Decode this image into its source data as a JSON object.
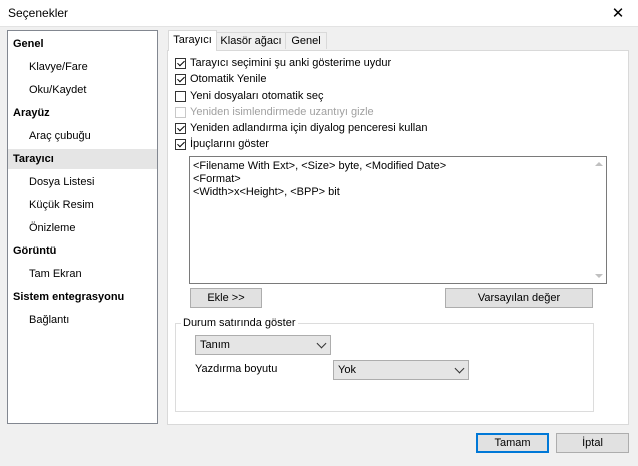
{
  "window": {
    "title": "Seçenekler",
    "close_glyph": "✕"
  },
  "sidebar": {
    "items": [
      {
        "label": "Genel",
        "type": "category"
      },
      {
        "label": "Klavye/Fare",
        "type": "sub"
      },
      {
        "label": "Oku/Kaydet",
        "type": "sub"
      },
      {
        "label": "Arayüz",
        "type": "category"
      },
      {
        "label": "Araç çubuğu",
        "type": "sub"
      },
      {
        "label": "Tarayıcı",
        "type": "category",
        "selected": true
      },
      {
        "label": "Dosya Listesi",
        "type": "sub"
      },
      {
        "label": "Küçük Resim",
        "type": "sub"
      },
      {
        "label": "Önizleme",
        "type": "sub"
      },
      {
        "label": "Görüntü",
        "type": "category"
      },
      {
        "label": "Tam Ekran",
        "type": "sub"
      },
      {
        "label": "Sistem entegrasyonu",
        "type": "category"
      },
      {
        "label": "Bağlantı",
        "type": "sub"
      }
    ]
  },
  "tabs": [
    {
      "label": "Tarayıcı",
      "active": true
    },
    {
      "label": "Klasör ağacı",
      "active": false
    },
    {
      "label": "Genel",
      "active": false
    }
  ],
  "options": [
    {
      "label": "Tarayıcı seçimini şu anki gösterime uydur",
      "checked": true,
      "enabled": true
    },
    {
      "label": "Otomatik Yenile",
      "checked": true,
      "enabled": true
    },
    {
      "label": "Yeni dosyaları otomatik seç",
      "checked": false,
      "enabled": true
    },
    {
      "label": "Yeniden isimlendirmede uzantıyı gizle",
      "checked": false,
      "enabled": false
    },
    {
      "label": "Yeniden adlandırma için diyalog penceresi kullan",
      "checked": true,
      "enabled": true
    },
    {
      "label": "İpuçlarını göster",
      "checked": true,
      "enabled": true
    }
  ],
  "tooltip_format": {
    "lines": [
      "<Filename With Ext>, <Size> byte, <Modified Date>",
      "<Format>",
      "<Width>x<Height>, <BPP> bit"
    ]
  },
  "buttons": {
    "add": "Ekle >>",
    "default_value": "Varsayılan değer",
    "ok": "Tamam",
    "cancel": "İptal"
  },
  "statusbar_group": {
    "title": "Durum satırında göster",
    "mode_value": "Tanım",
    "print_size_label": "Yazdırma boyutu",
    "print_size_value": "Yok"
  }
}
